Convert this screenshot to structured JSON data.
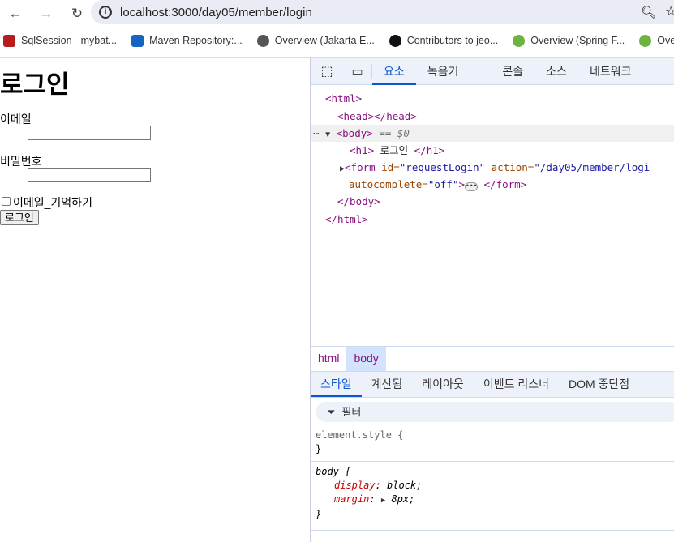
{
  "browser": {
    "url": "localhost:3000/day05/member/login",
    "bookmarks": [
      {
        "label": "SqlSession - mybat...",
        "icon": "book-icon",
        "color": "#b71c1c"
      },
      {
        "label": "Maven Repository:...",
        "icon": "maven-icon",
        "color": "#1565c0"
      },
      {
        "label": "Overview (Jakarta E...",
        "icon": "globe-icon",
        "color": "#555555"
      },
      {
        "label": "Contributors to jeo...",
        "icon": "github-icon",
        "color": "#111111"
      },
      {
        "label": "Overview (Spring F...",
        "icon": "spring-icon",
        "color": "#6db33f"
      },
      {
        "label": "Overview",
        "icon": "spring-icon",
        "color": "#6db33f"
      }
    ]
  },
  "page": {
    "title": "로그인",
    "email_label": "이메일",
    "email_value": "",
    "password_label": "비밀번호",
    "password_value": "",
    "remember_label": "이메일_기억하기",
    "remember_checked": false,
    "submit_label": "로그인"
  },
  "devtools": {
    "tabs": [
      "요소",
      "녹음기",
      "콘솔",
      "소스",
      "네트워크"
    ],
    "active_tab": "요소",
    "dom": {
      "html_open": "<html>",
      "head": "<head></head>",
      "body_open": "<body>",
      "body_marker": "== $0",
      "h1_open": "<h1>",
      "h1_text": " 로그인 ",
      "h1_close": "</h1>",
      "form_tag": "<form ",
      "form_id_attr": "id=",
      "form_id_val": "\"requestLogin\"",
      "form_action_attr": " action=",
      "form_action_val": "\"/day05/member/logi",
      "form_ac_attr": "autocomplete=",
      "form_ac_val": "\"off\"",
      "form_gt": ">",
      "form_close": "</form>",
      "body_close": "</body>",
      "html_close": "</html>"
    },
    "breadcrumbs": [
      "html",
      "body"
    ],
    "style_tabs": [
      "스타일",
      "계산됨",
      "레이아웃",
      "이벤트 리스너",
      "DOM 중단점"
    ],
    "filter_placeholder": "필터",
    "rules": {
      "element_style": "element.style {",
      "close": "}",
      "body_selector": "body {",
      "display_name": "display",
      "display_value": "block;",
      "margin_name": "margin",
      "margin_value": "8px;"
    }
  }
}
